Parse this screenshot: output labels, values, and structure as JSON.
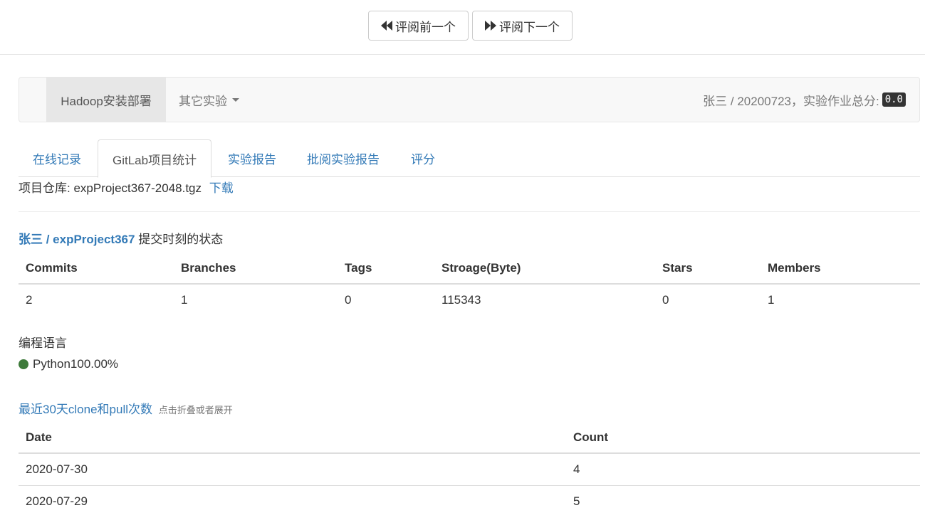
{
  "review": {
    "prev_label": "评阅前一个",
    "next_label": "评阅下一个"
  },
  "navbar": {
    "active_item": "Hadoop安装部署",
    "dropdown_label": "其它实验",
    "student_info": "张三 / 20200723，实验作业总分:",
    "total_score": "0.0"
  },
  "tabs": [
    {
      "label": "在线记录"
    },
    {
      "label": "GitLab项目统计"
    },
    {
      "label": "实验报告"
    },
    {
      "label": "批阅实验报告"
    },
    {
      "label": "评分"
    }
  ],
  "repo": {
    "label": "项目仓库: expProject367-2048.tgz",
    "download_label": "下载"
  },
  "project": {
    "link": "张三 / expProject367",
    "suffix": "提交时刻的状态"
  },
  "stats": {
    "headers": [
      "Commits",
      "Branches",
      "Tags",
      "Stroage(Byte)",
      "Stars",
      "Members"
    ],
    "values": [
      "2",
      "1",
      "0",
      "115343",
      "0",
      "1"
    ]
  },
  "languages": {
    "heading": "编程语言",
    "items": [
      {
        "name": "Python100.00%",
        "color": "#3d7a3a"
      }
    ]
  },
  "clones": {
    "heading": "最近30天clone和pull次数",
    "hint": "点击折叠或者展开",
    "headers": [
      "Date",
      "Count"
    ],
    "rows": [
      {
        "date": "2020-07-30",
        "count": "4"
      },
      {
        "date": "2020-07-29",
        "count": "5"
      }
    ]
  }
}
